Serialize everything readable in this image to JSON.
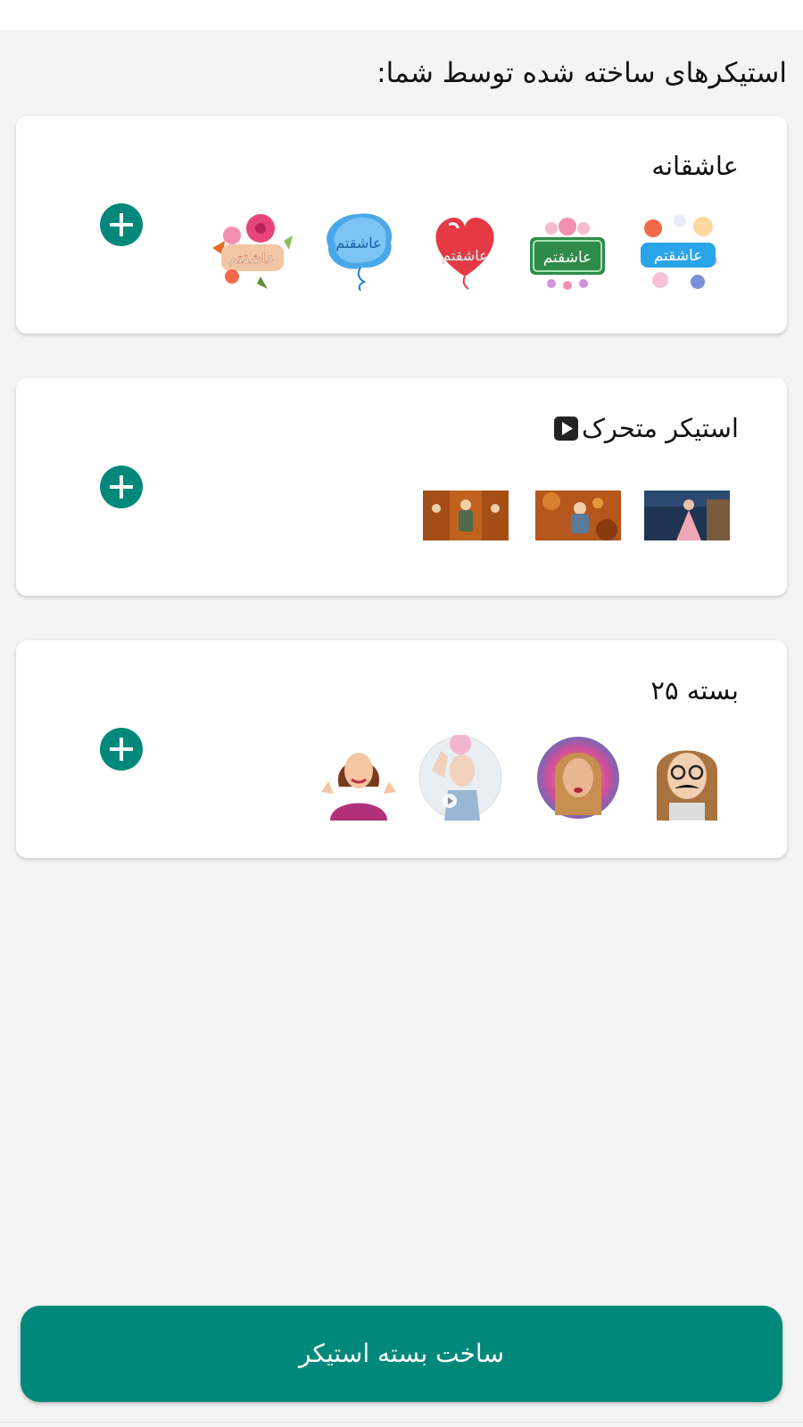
{
  "page": {
    "heading": "استیکرهای ساخته شده توسط شما:",
    "create_button_label": "ساخت بسته استیکر"
  },
  "colors": {
    "accent": "#00897b",
    "background": "#f4f4f4",
    "card": "#ffffff"
  },
  "packs": [
    {
      "title": "عاشقانه",
      "animated": false,
      "stickers": [
        {
          "type": "text-sticker",
          "label": "عاشقتم"
        },
        {
          "type": "text-sticker",
          "label": "عاشقتم"
        },
        {
          "type": "text-sticker",
          "label": "عاشقتم"
        },
        {
          "type": "text-sticker",
          "label": "عاشقتم"
        },
        {
          "type": "text-sticker",
          "label": "عاشقتم"
        }
      ]
    },
    {
      "title": "استیکر متحرک",
      "animated": true,
      "stickers": [
        {
          "type": "photo"
        },
        {
          "type": "photo"
        },
        {
          "type": "photo"
        }
      ]
    },
    {
      "title": "بسته ۲۵",
      "animated": false,
      "stickers": [
        {
          "type": "photo"
        },
        {
          "type": "photo"
        },
        {
          "type": "photo"
        },
        {
          "type": "photo"
        }
      ]
    }
  ],
  "icons": {
    "add": "plus-circle-icon",
    "animated": "play-icon"
  }
}
